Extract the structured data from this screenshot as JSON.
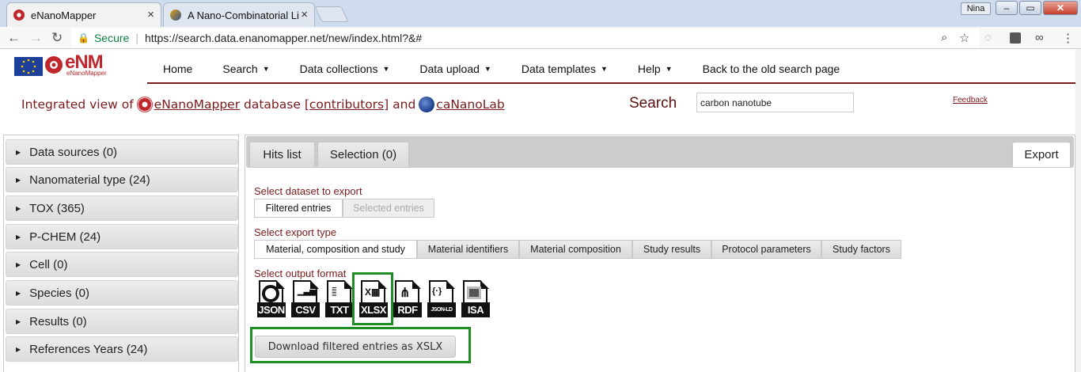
{
  "browser": {
    "tabs": [
      {
        "title": "eNanoMapper",
        "active": true,
        "close": "×"
      },
      {
        "title": "A Nano-Combinatorial Li",
        "active": false,
        "close": "×"
      }
    ],
    "user": "Nina",
    "window_buttons": {
      "minimize": "–",
      "maximize": "▭",
      "close": "✕"
    },
    "secure_label": "Secure",
    "url": "https://search.data.enanomapper.net/new/index.html?&#",
    "icons": [
      "back-icon",
      "forward-icon",
      "reload-icon",
      "lock-icon",
      "zoom-icon",
      "bookmark-star-icon",
      "extension-icon",
      "extension-icon-2",
      "extension-icon-3",
      "menu-icon"
    ]
  },
  "logo": {
    "brand": "eNM",
    "subtitle": "eNanoMapper"
  },
  "nav": {
    "items": [
      {
        "label": "Home",
        "dropdown": false
      },
      {
        "label": "Search",
        "dropdown": true
      },
      {
        "label": "Data collections",
        "dropdown": true
      },
      {
        "label": "Data upload",
        "dropdown": true
      },
      {
        "label": "Data templates",
        "dropdown": true
      },
      {
        "label": "Help",
        "dropdown": true
      },
      {
        "label": "Back to the old search page",
        "dropdown": false
      }
    ]
  },
  "intro": {
    "prefix": "Integrated view of",
    "db1": "eNanoMapper",
    "middle": "database",
    "contributors": "[contributors]",
    "and": "and",
    "db2": "caNanoLab"
  },
  "search": {
    "label": "Search",
    "value": "carbon nanotube"
  },
  "feedback": "Feedback",
  "sidebar": {
    "items": [
      {
        "label": "Data sources (0)"
      },
      {
        "label": "Nanomaterial type (24)"
      },
      {
        "label": "TOX (365)"
      },
      {
        "label": "P-CHEM (24)"
      },
      {
        "label": "Cell (0)"
      },
      {
        "label": "Species (0)"
      },
      {
        "label": "Results (0)"
      },
      {
        "label": "References Years (24)"
      }
    ]
  },
  "tabs": {
    "hits": "Hits list",
    "selection": "Selection (0)",
    "export": "Export"
  },
  "export": {
    "dataset_label": "Select dataset to export",
    "dataset_options": [
      "Filtered entries",
      "Selected entries"
    ],
    "type_label": "Select export type",
    "type_options": [
      "Material, composition and study",
      "Material identifiers",
      "Material composition",
      "Study results",
      "Protocol parameters",
      "Study factors"
    ],
    "format_label": "Select output format",
    "formats": [
      {
        "label": "JSON",
        "icon": "json-icon"
      },
      {
        "label": "CSV",
        "icon": "csv-icon"
      },
      {
        "label": "TXT",
        "icon": "txt-icon"
      },
      {
        "label": "XLSX",
        "icon": "xlsx-icon"
      },
      {
        "label": "RDF",
        "icon": "rdf-icon"
      },
      {
        "label": "JSON-LD",
        "icon": "json-ld-icon"
      },
      {
        "label": "ISA",
        "icon": "isa-icon"
      }
    ],
    "selected_format": "XLSX",
    "download_label": "Download filtered entries as XSLX",
    "highlight_color": "#1e8e25"
  },
  "colors": {
    "brand_maroon": "#7a1a1a",
    "highlight_green": "#1e8e25"
  }
}
